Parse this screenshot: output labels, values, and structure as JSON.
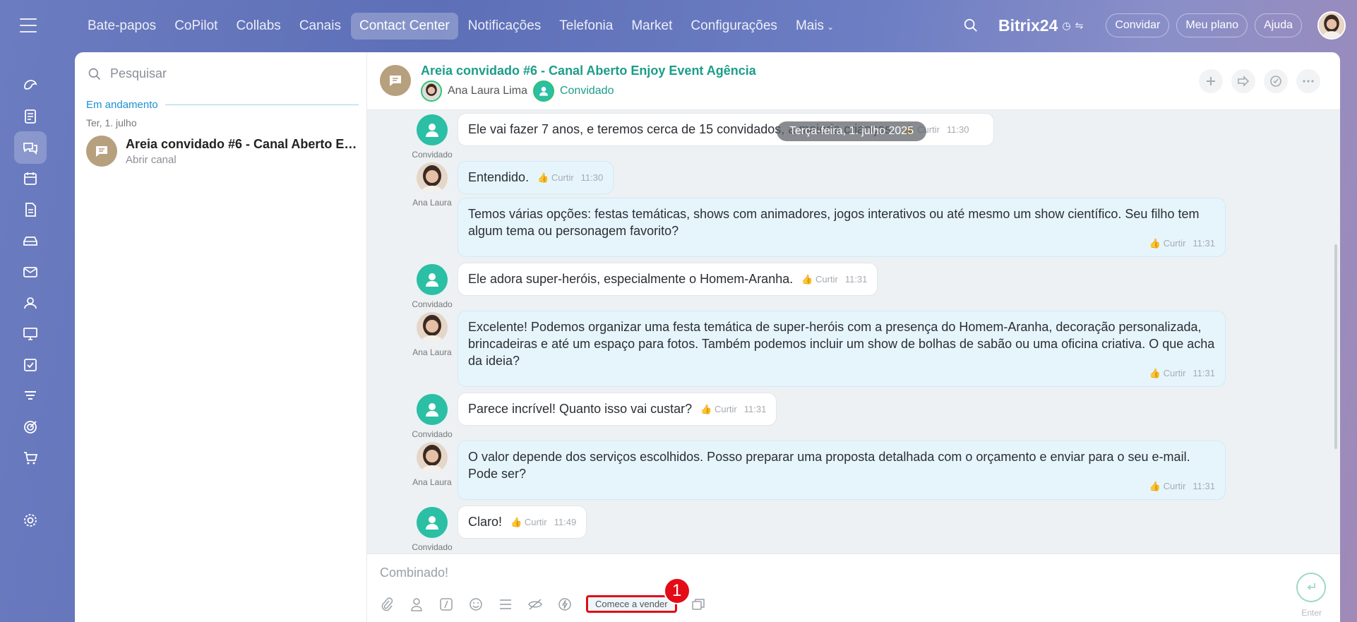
{
  "nav": {
    "items": [
      {
        "label": "Bate-papos",
        "active": false
      },
      {
        "label": "CoPilot",
        "active": false
      },
      {
        "label": "Collabs",
        "active": false
      },
      {
        "label": "Canais",
        "active": false
      },
      {
        "label": "Contact Center",
        "active": true
      },
      {
        "label": "Notificações",
        "active": false
      },
      {
        "label": "Telefonia",
        "active": false
      },
      {
        "label": "Market",
        "active": false
      },
      {
        "label": "Configurações",
        "active": false
      },
      {
        "label": "Mais",
        "active": false
      }
    ],
    "brand": "Bitrix24",
    "invite": "Convidar",
    "plan": "Meu plano",
    "help": "Ajuda"
  },
  "rail": {
    "icons": [
      "copilot-icon",
      "feed-icon",
      "chat-icon",
      "calendar-icon",
      "docs-icon",
      "drive-icon",
      "mail-icon",
      "contacts-icon",
      "board-icon",
      "tasks-icon",
      "filter-icon",
      "target-icon",
      "cart-icon",
      "settings-icon"
    ]
  },
  "sidebar": {
    "search_placeholder": "Pesquisar",
    "section": "Em andamento",
    "date": "Ter, 1. julho",
    "chat": {
      "title": "Areia convidado #6 - Canal Aberto Enj...",
      "subtitle": "Abrir canal"
    }
  },
  "header": {
    "title": "Areia convidado #6 - Canal Aberto Enjoy Event Agência",
    "member1": "Ana Laura Lima",
    "member2": "Convidado"
  },
  "messages": {
    "date_chip": "Terça-feira, 1. julho 2025",
    "like_label": "Curtir",
    "guest_name": "Convidado",
    "agent_name": "Ana Laura",
    "items": [
      {
        "text": "Ele vai fazer 7 anos, e teremos cerca de 15 convidados, a maioria crianças.",
        "time": "11:30"
      },
      {
        "text": "Entendido.",
        "time": "11:30"
      },
      {
        "text": "Temos várias opções: festas temáticas, shows com animadores, jogos interativos ou até mesmo um show científico. Seu filho tem algum tema ou personagem favorito?",
        "time": "11:31"
      },
      {
        "text": "Ele adora super-heróis, especialmente o Homem-Aranha.",
        "time": "11:31"
      },
      {
        "text": "Excelente! Podemos organizar uma festa temática de super-heróis com a presença do Homem-Aranha, decoração personalizada, brincadeiras e até um espaço para fotos. Também podemos incluir um show de bolhas de sabão ou uma oficina criativa. O que acha da ideia?",
        "time": "11:31"
      },
      {
        "text": "Parece incrível! Quanto isso vai custar?",
        "time": "11:31"
      },
      {
        "text": "O valor depende dos serviços escolhidos. Posso preparar uma proposta detalhada com o orçamento e enviar para o seu e-mail. Pode ser?",
        "time": "11:31"
      },
      {
        "text": "Claro!",
        "time": "11:49"
      }
    ]
  },
  "composer": {
    "value": "Combinado!",
    "sell_label": "Comece a vender",
    "badge": "1",
    "send_hint": "Enter"
  }
}
